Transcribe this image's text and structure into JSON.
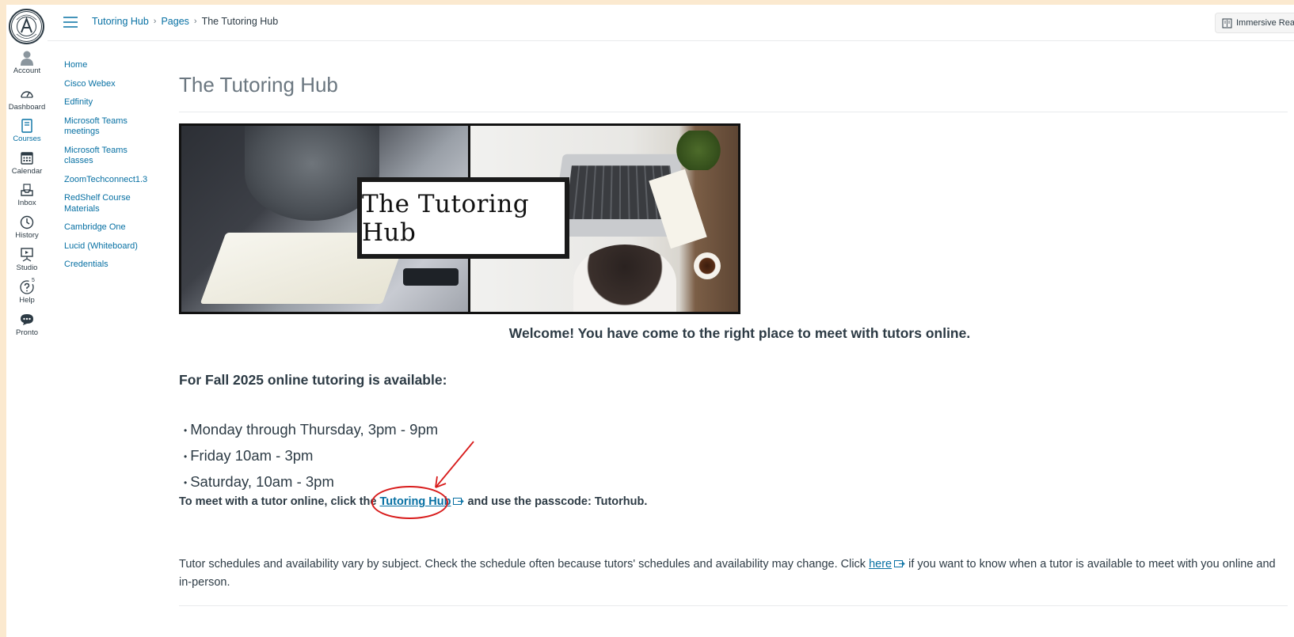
{
  "global_nav": {
    "logo_icon": "el-camino-college-seal",
    "items": [
      {
        "label": "Account",
        "icon": "user-avatar-icon"
      },
      {
        "label": "Dashboard",
        "icon": "dashboard-gauge-icon"
      },
      {
        "label": "Courses",
        "icon": "courses-book-icon",
        "active": true
      },
      {
        "label": "Calendar",
        "icon": "calendar-icon"
      },
      {
        "label": "Inbox",
        "icon": "inbox-icon"
      },
      {
        "label": "History",
        "icon": "history-clock-icon"
      },
      {
        "label": "Studio",
        "icon": "studio-icon"
      },
      {
        "label": "Help",
        "icon": "help-icon",
        "badge": "5"
      },
      {
        "label": "Pronto",
        "icon": "pronto-chat-icon"
      }
    ]
  },
  "header": {
    "breadcrumb": [
      "Tutoring Hub",
      "Pages",
      "The Tutoring Hub"
    ],
    "immersive_reader_label": "Immersive Reader"
  },
  "course_nav": {
    "items": [
      "Home",
      "Cisco Webex",
      "Edfinity",
      "Microsoft Teams meetings",
      "Microsoft Teams classes",
      "ZoomTechconnect1.3",
      "RedShelf Course Materials",
      "Cambridge One",
      "Lucid (Whiteboard)",
      "Credentials"
    ]
  },
  "main": {
    "page_title": "The Tutoring Hub",
    "banner_text": "The Tutoring Hub",
    "welcome": "Welcome!  You have come to the right place to meet with tutors online.",
    "fall_heading": "For Fall 2025 online tutoring is available:",
    "hours": [
      "Monday through Thursday, 3pm - 9pm",
      "Friday 10am - 3pm",
      "Saturday, 10am - 3pm"
    ],
    "meet_prefix": "To meet with a tutor online, click the ",
    "meet_link": "Tutoring Hub",
    "meet_suffix": " and use the passcode: Tutorhub.",
    "schedule_prefix": "Tutor schedules and availability vary by subject.  Check the schedule often because tutors' schedules and availability may change.  Click ",
    "schedule_link": "here",
    "schedule_suffix": " if you want to know when a tutor is available to meet with you online and in-person."
  },
  "colors": {
    "link": "#0770a3",
    "text": "#2d3b45",
    "highlight_circle": "#d81b1b"
  }
}
